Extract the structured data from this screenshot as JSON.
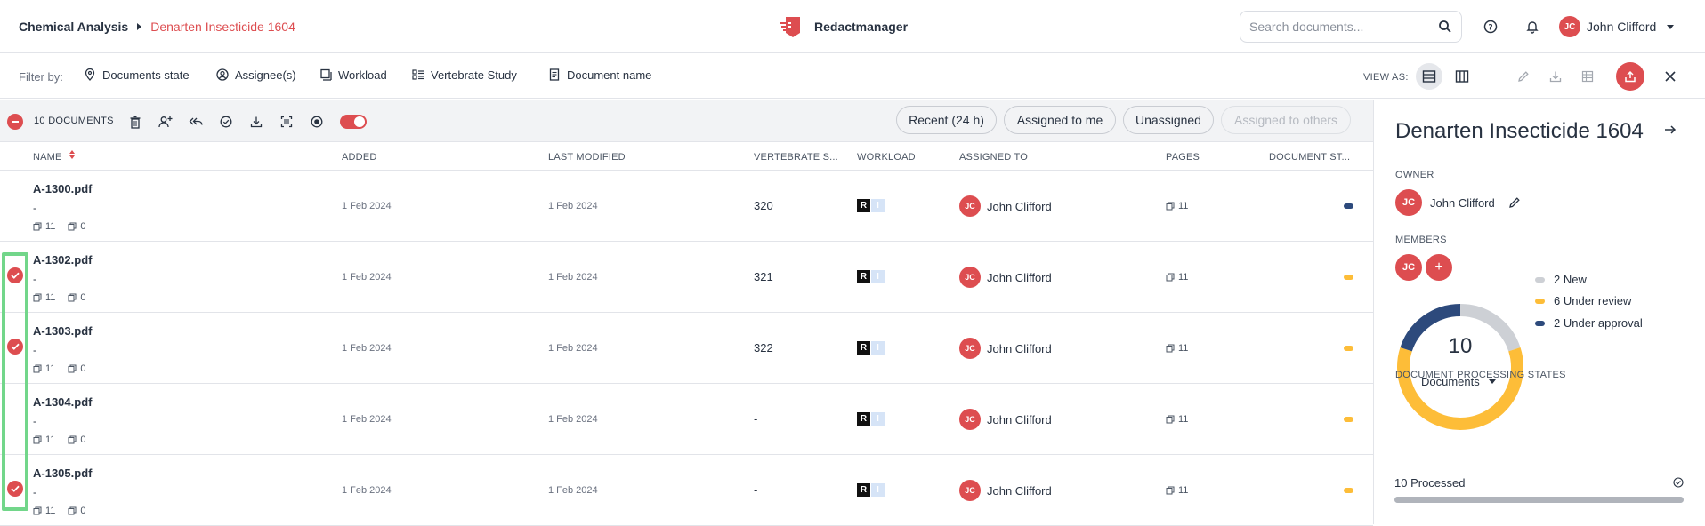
{
  "breadcrumb": {
    "parent": "Chemical Analysis",
    "current": "Denarten Insecticide 1604"
  },
  "brand": {
    "name": "Redactmanager",
    "color": "#dd4d50"
  },
  "search": {
    "placeholder": "Search documents..."
  },
  "user": {
    "initials": "JC",
    "name": "John Clifford"
  },
  "filters": {
    "label": "Filter by:",
    "items": [
      {
        "label": "Documents state",
        "icon": "location-pin-icon"
      },
      {
        "label": "Assignee(s)",
        "icon": "user-circle-icon"
      },
      {
        "label": "Workload",
        "icon": "workload-icon"
      },
      {
        "label": "Vertebrate Study",
        "icon": "list-icon"
      },
      {
        "label": "Document name",
        "icon": "document-icon"
      }
    ]
  },
  "view": {
    "label": "VIEW AS:",
    "selected": "list"
  },
  "bulk": {
    "count_label": "10 DOCUMENTS",
    "chips": [
      "Recent (24 h)",
      "Assigned to me",
      "Unassigned",
      "Assigned to others"
    ],
    "toggle_on": true
  },
  "table": {
    "columns": [
      "NAME",
      "ADDED",
      "LAST MODIFIED",
      "VERTEBRATE S...",
      "WORKLOAD",
      "ASSIGNED TO",
      "PAGES",
      "DOCUMENT ST..."
    ],
    "rows": [
      {
        "name": "A-1300.pdf",
        "sub": "-",
        "pages_meta": "11",
        "annotations": "0",
        "added": "1 Feb 2024",
        "modified": "1 Feb 2024",
        "vertebrate": "320",
        "wl_r": "R",
        "wl_i": "I",
        "assignee_initials": "JC",
        "assignee": "John Clifford",
        "pages": "11",
        "status_color": "#2d4a7c",
        "selected": false
      },
      {
        "name": "A-1302.pdf",
        "sub": "-",
        "pages_meta": "11",
        "annotations": "0",
        "added": "1 Feb 2024",
        "modified": "1 Feb 2024",
        "vertebrate": "321",
        "wl_r": "R",
        "wl_i": "I",
        "assignee_initials": "JC",
        "assignee": "John Clifford",
        "pages": "11",
        "status_color": "#fdbd38",
        "selected": true
      },
      {
        "name": "A-1303.pdf",
        "sub": "-",
        "pages_meta": "11",
        "annotations": "0",
        "added": "1 Feb 2024",
        "modified": "1 Feb 2024",
        "vertebrate": "322",
        "wl_r": "R",
        "wl_i": "I",
        "assignee_initials": "JC",
        "assignee": "John Clifford",
        "pages": "11",
        "status_color": "#fdbd38",
        "selected": true
      },
      {
        "name": "A-1304.pdf",
        "sub": "-",
        "pages_meta": "11",
        "annotations": "0",
        "added": "1 Feb 2024",
        "modified": "1 Feb 2024",
        "vertebrate": "-",
        "wl_r": "R",
        "wl_i": "I",
        "assignee_initials": "JC",
        "assignee": "John Clifford",
        "pages": "11",
        "status_color": "#fdbd38",
        "selected": false
      },
      {
        "name": "A-1305.pdf",
        "sub": "-",
        "pages_meta": "11",
        "annotations": "0",
        "added": "1 Feb 2024",
        "modified": "1 Feb 2024",
        "vertebrate": "-",
        "wl_r": "R",
        "wl_i": "I",
        "assignee_initials": "JC",
        "assignee": "John Clifford",
        "pages": "11",
        "status_color": "#fdbd38",
        "selected": true
      }
    ]
  },
  "panel": {
    "title": "Denarten Insecticide 1604",
    "owner_label": "OWNER",
    "owner_initials": "JC",
    "owner_name": "John Clifford",
    "members_label": "MEMBERS",
    "member_initials": "JC",
    "add_member": "+",
    "total": "10",
    "total_label": "Documents",
    "legend": [
      {
        "label": "2 New",
        "value": 2,
        "color": "#cdd0d5"
      },
      {
        "label": "6 Under review",
        "value": 6,
        "color": "#fdbd38"
      },
      {
        "label": "2 Under approval",
        "value": 2,
        "color": "#2d4a7c"
      }
    ],
    "processing_label": "DOCUMENT PROCESSING STATES",
    "processed_label": "10 Processed",
    "processed_fraction": 1.0
  },
  "colors": {
    "accent": "#dd4d50",
    "selection_outline": "#72d68a"
  }
}
